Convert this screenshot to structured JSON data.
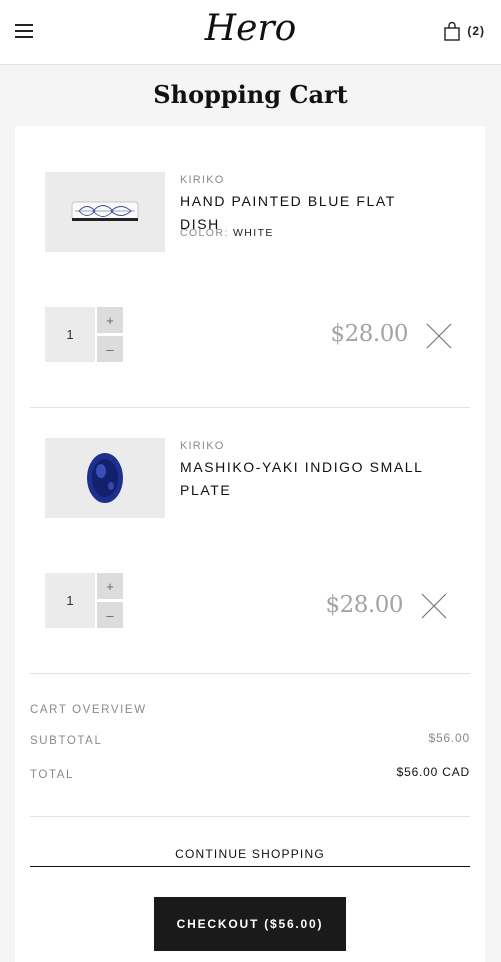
{
  "header": {
    "logo_text": "Hero",
    "cart_count": "(2)"
  },
  "page": {
    "title": "Shopping Cart"
  },
  "cart": {
    "items": [
      {
        "brand": "KIRIKO",
        "title": "HAND PAINTED BLUE FLAT DISH",
        "variant_label": "COLOR:",
        "variant_value": "WHITE",
        "quantity": "1",
        "plus_label": "+",
        "minus_label": "–",
        "price": "$28.00"
      },
      {
        "brand": "KIRIKO",
        "title": "MASHIKO-YAKI INDIGO SMALL PLATE",
        "quantity": "1",
        "plus_label": "+",
        "minus_label": "–",
        "price": "$28.00"
      }
    ]
  },
  "overview": {
    "heading": "CART OVERVIEW",
    "subtotal_label": "SUBTOTAL",
    "subtotal_value": "$56.00",
    "total_label": "TOTAL",
    "total_value": "$56.00 CAD"
  },
  "actions": {
    "continue_label": "CONTINUE SHOPPING",
    "checkout_label": "CHECKOUT ($56.00)"
  },
  "icons": {
    "menu": "hamburger-icon",
    "cart": "shopping-bag-icon",
    "remove": "close-icon"
  },
  "colors": {
    "checkout_bg": "#1a1a1a",
    "price": "#a4a4a4",
    "muted": "#8a8a8a",
    "indigo": "#1d2f8f"
  }
}
